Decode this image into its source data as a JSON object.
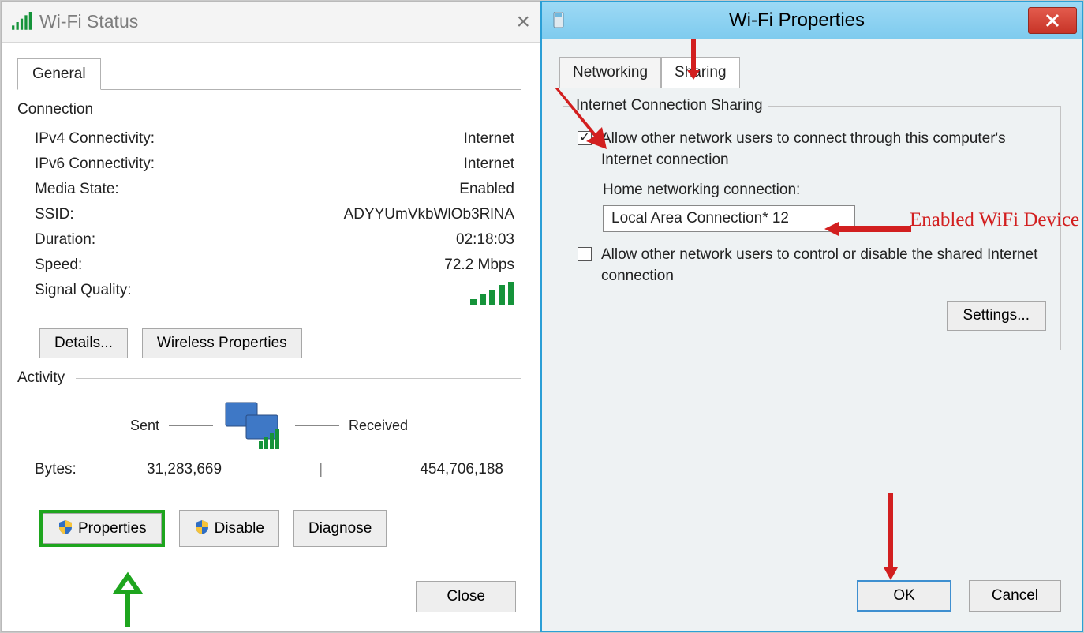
{
  "status_dialog": {
    "title": "Wi-Fi Status",
    "tab_general": "General",
    "section_connection": "Connection",
    "fields": {
      "ipv4_label": "IPv4 Connectivity:",
      "ipv4_value": "Internet",
      "ipv6_label": "IPv6 Connectivity:",
      "ipv6_value": "Internet",
      "media_label": "Media State:",
      "media_value": "Enabled",
      "ssid_label": "SSID:",
      "ssid_value": "ADYYUmVkbWlOb3RlNA",
      "duration_label": "Duration:",
      "duration_value": "02:18:03",
      "speed_label": "Speed:",
      "speed_value": "72.2 Mbps",
      "signal_label": "Signal Quality:"
    },
    "details_btn": "Details...",
    "wireless_btn": "Wireless Properties",
    "section_activity": "Activity",
    "sent_label": "Sent",
    "received_label": "Received",
    "bytes_label": "Bytes:",
    "bytes_sent": "31,283,669",
    "bytes_recv": "454,706,188",
    "properties_btn": "Properties",
    "disable_btn": "Disable",
    "diagnose_btn": "Diagnose",
    "close_btn": "Close"
  },
  "props_dialog": {
    "title": "Wi-Fi Properties",
    "tab_networking": "Networking",
    "tab_sharing": "Sharing",
    "group_ics": "Internet Connection Sharing",
    "chk_allow_connect": "Allow other network users to connect through this computer's Internet connection",
    "home_label": "Home networking connection:",
    "home_value": "Local Area Connection* 12",
    "chk_allow_control": "Allow other network users to control or disable the shared Internet connection",
    "settings_btn": "Settings...",
    "ok_btn": "OK",
    "cancel_btn": "Cancel"
  },
  "annotation_text": "Enabled WiFi Device"
}
